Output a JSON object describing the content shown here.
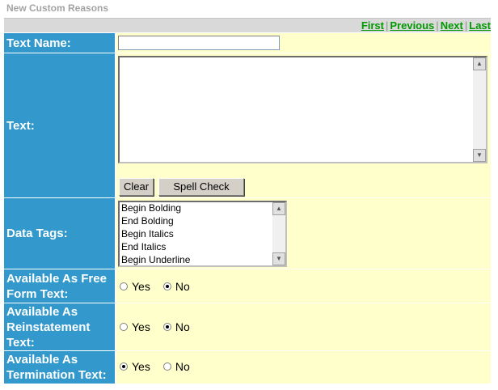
{
  "page": {
    "title": "New Custom Reasons"
  },
  "nav": {
    "first": "First",
    "previous": "Previous",
    "next": "Next",
    "last": "Last",
    "separator": "|"
  },
  "form": {
    "text_name": {
      "label": "Text Name:",
      "value": ""
    },
    "text": {
      "label": "Text:",
      "value": "",
      "clear_label": "Clear",
      "spell_check_label": "Spell Check"
    },
    "data_tags": {
      "label": "Data Tags:",
      "options": [
        "Begin Bolding",
        "End Bolding",
        "Begin Italics",
        "End Italics",
        "Begin Underline"
      ]
    },
    "free_form": {
      "label_line1": "Available As Free",
      "label_line2": "Form Text:",
      "yes": "Yes",
      "no": "No",
      "selected": "no"
    },
    "reinstatement": {
      "label_line1": "Available As",
      "label_line2": "Reinstatement",
      "label_line3": "Text:",
      "yes": "Yes",
      "no": "No",
      "selected": "no"
    },
    "termination": {
      "label_line1": "Available As",
      "label_line2": "Termination Text:",
      "yes": "Yes",
      "no": "No",
      "selected": "yes"
    }
  },
  "colors": {
    "label_bg": "#3399cc",
    "value_bg": "#ffffcc",
    "nav_link": "#009900",
    "title": "#a3a3a3"
  }
}
